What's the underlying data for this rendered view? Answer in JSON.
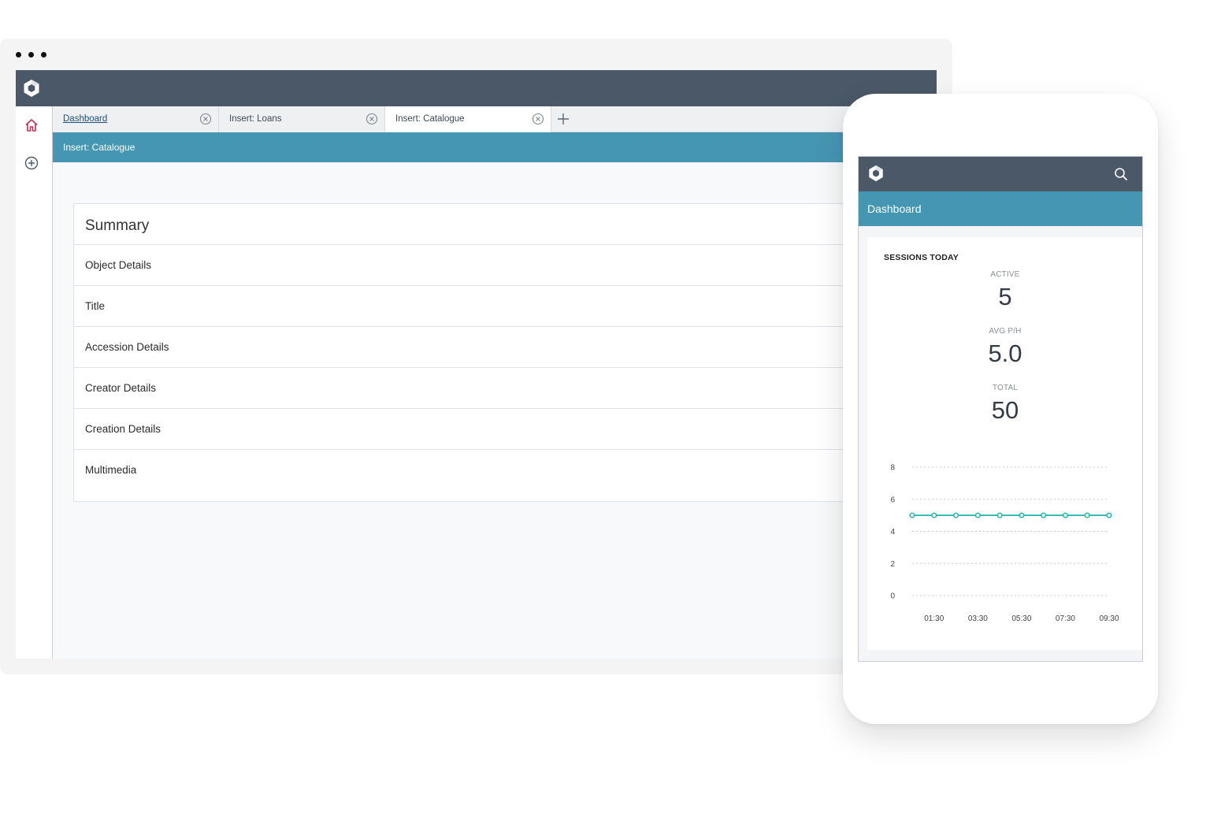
{
  "desktop": {
    "tabs": [
      {
        "label": "Dashboard"
      },
      {
        "label": "Insert: Loans"
      },
      {
        "label": "Insert: Catalogue"
      }
    ],
    "banner_title": "Insert: Catalogue",
    "summary": {
      "title": "Summary",
      "rows": [
        "Object Details",
        "Title",
        "Accession Details",
        "Creator Details",
        "Creation Details",
        "Multimedia"
      ]
    }
  },
  "phone": {
    "banner_title": "Dashboard",
    "sessions": {
      "title": "SESSIONS TODAY",
      "active_label": "ACTIVE",
      "active_value": "5",
      "avg_label": "AVG P/H",
      "avg_value": "5.0",
      "total_label": "TOTAL",
      "total_value": "50"
    }
  },
  "colors": {
    "topbar": "#4a5868",
    "banner": "#4596b3",
    "accent_home": "#c0304f",
    "series": "#1fb5ad"
  },
  "icons": [
    "app-logo-icon",
    "home-icon",
    "add-circle-icon",
    "close-circle-icon",
    "plus-icon",
    "search-icon"
  ],
  "chart_data": {
    "type": "line",
    "x": [
      "01:00",
      "01:30",
      "02:30",
      "03:30",
      "04:30",
      "05:30",
      "06:30",
      "07:30",
      "08:30",
      "09:30"
    ],
    "x_tick_labels": [
      "01:30",
      "03:30",
      "05:30",
      "07:30",
      "09:30"
    ],
    "series": [
      {
        "values": [
          5,
          5,
          5,
          5,
          5,
          5,
          5,
          5,
          5,
          5
        ]
      }
    ],
    "ylim": [
      0,
      8
    ],
    "y_ticks": [
      0,
      2,
      4,
      6,
      8
    ],
    "grid": true
  }
}
